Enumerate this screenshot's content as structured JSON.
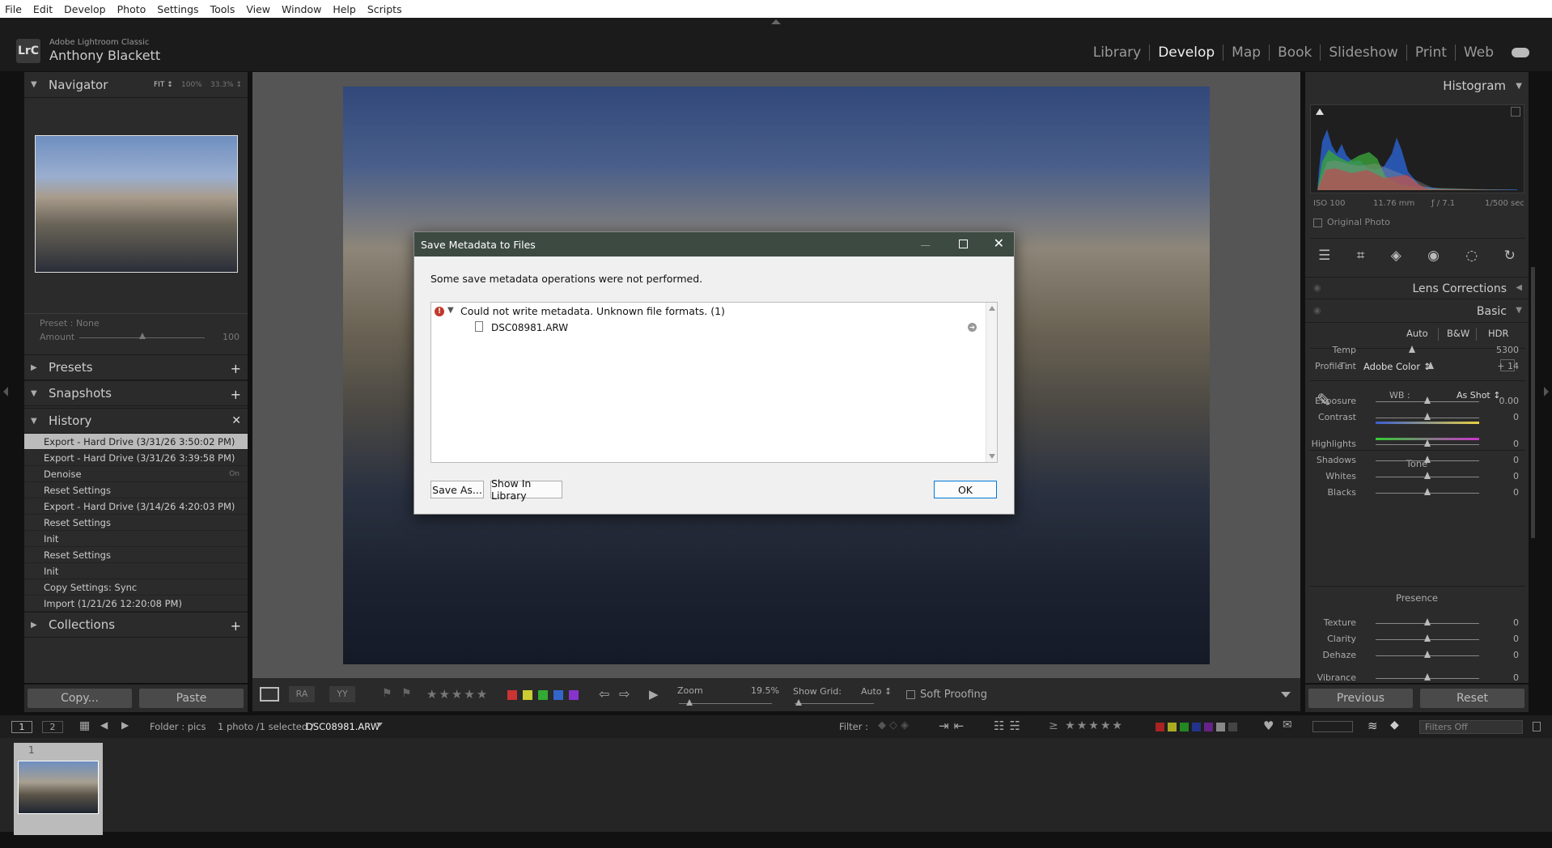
{
  "menu": [
    "File",
    "Edit",
    "Develop",
    "Photo",
    "Settings",
    "Tools",
    "View",
    "Window",
    "Help",
    "Scripts"
  ],
  "identity": {
    "app": "Adobe Lightroom Classic",
    "user": "Anthony Blackett",
    "logo": "LrC"
  },
  "modules": [
    "Library",
    "Develop",
    "Map",
    "Book",
    "Slideshow",
    "Print",
    "Web"
  ],
  "navigator": {
    "title": "Navigator",
    "zoom": [
      "FIT ↕",
      "100%",
      "33.3% ↕"
    ]
  },
  "preset_amount": {
    "preset_label": "Preset :",
    "preset_value": "None",
    "amount_label": "Amount",
    "amount_value": "100"
  },
  "panels": {
    "presets": "Presets",
    "snapshots": "Snapshots",
    "history": "History",
    "collections": "Collections"
  },
  "history": [
    {
      "label": "Export - Hard Drive (3/31/26 3:50:02 PM)",
      "extra": ""
    },
    {
      "label": "Export - Hard Drive (3/31/26 3:39:58 PM)",
      "extra": ""
    },
    {
      "label": "Denoise",
      "extra": "On"
    },
    {
      "label": "Reset Settings",
      "extra": ""
    },
    {
      "label": "Export - Hard Drive (3/14/26 4:20:03 PM)",
      "extra": ""
    },
    {
      "label": "Reset Settings",
      "extra": ""
    },
    {
      "label": "Init",
      "extra": ""
    },
    {
      "label": "Reset Settings",
      "extra": ""
    },
    {
      "label": "Init",
      "extra": ""
    },
    {
      "label": "Copy Settings: Sync",
      "extra": ""
    },
    {
      "label": "Import (1/21/26 12:20:08 PM)",
      "extra": ""
    }
  ],
  "left_buttons": {
    "copy": "Copy...",
    "paste": "Paste"
  },
  "toolbar": {
    "zoom_label": "Zoom",
    "zoom_value": "19.5%",
    "grid_label": "Show Grid:",
    "grid_value": "Auto ↕",
    "soft_proof": "Soft Proofing",
    "stars": "★★★★★"
  },
  "right": {
    "histogram": "Histogram",
    "exif": [
      "ISO 100",
      "11.76 mm",
      "ƒ / 7.1",
      "1/500 sec"
    ],
    "original_photo": "Original Photo",
    "lens_corrections": "Lens Corrections",
    "basic": "Basic",
    "treatments": [
      "Auto",
      "B&W",
      "HDR"
    ],
    "profile_label": "Profile :",
    "profile_value": "Adobe Color ↕",
    "wb_label": "WB :",
    "wb_value": "As Shot ↕",
    "tone": "Tone",
    "presence": "Presence"
  },
  "sliders": [
    {
      "label": "Temp",
      "value": "5300",
      "pos": 0.35
    },
    {
      "label": "Tint",
      "value": "+ 14",
      "pos": 0.53
    },
    {
      "label": "Exposure",
      "value": "0.00",
      "pos": 0.5
    },
    {
      "label": "Contrast",
      "value": "0",
      "pos": 0.5
    },
    {
      "label": "Highlights",
      "value": "0",
      "pos": 0.5
    },
    {
      "label": "Shadows",
      "value": "0",
      "pos": 0.5
    },
    {
      "label": "Whites",
      "value": "0",
      "pos": 0.5
    },
    {
      "label": "Blacks",
      "value": "0",
      "pos": 0.5
    },
    {
      "label": "Texture",
      "value": "0",
      "pos": 0.5
    },
    {
      "label": "Clarity",
      "value": "0",
      "pos": 0.5
    },
    {
      "label": "Dehaze",
      "value": "0",
      "pos": 0.5
    },
    {
      "label": "Vibrance",
      "value": "0",
      "pos": 0.5
    }
  ],
  "right_buttons": {
    "previous": "Previous",
    "reset": "Reset"
  },
  "filmbar": {
    "folder": "Folder : pics",
    "count": "1 photo /1 selected /",
    "file": "DSC08981.ARW",
    "filter_label": "Filter :",
    "filters_off": "Filters Off",
    "rating": "≥ ★★★★★",
    "page1": "1",
    "page2": "2"
  },
  "filmstrip": {
    "index": "1"
  },
  "dialog": {
    "title": "Save Metadata to Files",
    "message": "Some save metadata operations were not performed.",
    "error": "Could not write metadata. Unknown file formats. (1)",
    "file": "DSC08981.ARW",
    "save_as": "Save As...",
    "show_in_library": "Show In Library",
    "ok": "OK"
  }
}
